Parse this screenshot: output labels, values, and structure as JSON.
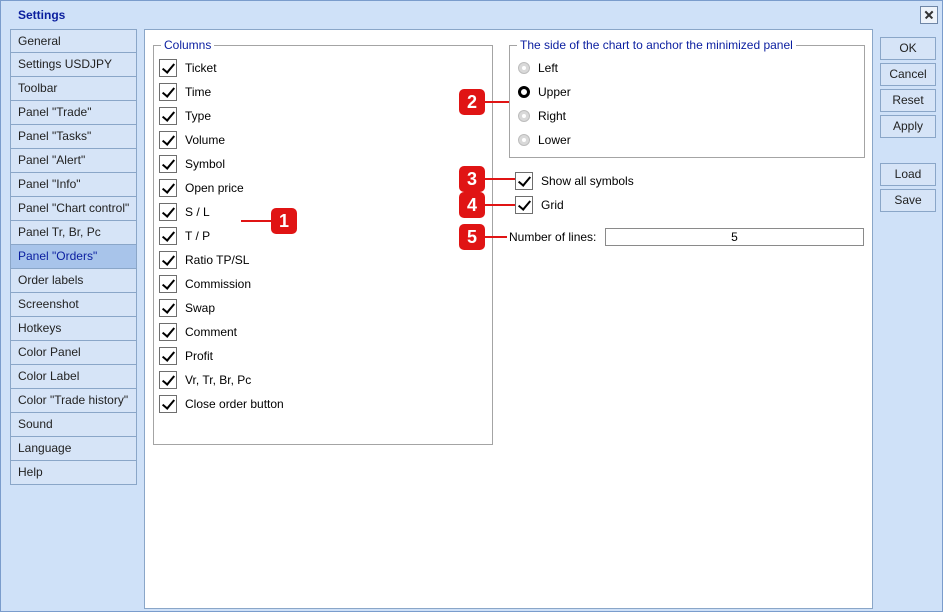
{
  "window": {
    "title": "Settings"
  },
  "sidebar": {
    "items": [
      {
        "label": "General"
      },
      {
        "label": "Settings USDJPY"
      },
      {
        "label": "Toolbar"
      },
      {
        "label": "Panel \"Trade\""
      },
      {
        "label": "Panel \"Tasks\""
      },
      {
        "label": "Panel \"Alert\""
      },
      {
        "label": "Panel \"Info\""
      },
      {
        "label": "Panel \"Chart control\""
      },
      {
        "label": "Panel Tr, Br, Pc"
      },
      {
        "label": "Panel \"Orders\"",
        "active": true
      },
      {
        "label": "Order labels"
      },
      {
        "label": "Screenshot"
      },
      {
        "label": "Hotkeys"
      },
      {
        "label": "Color Panel"
      },
      {
        "label": "Color Label"
      },
      {
        "label": "Color \"Trade history\""
      },
      {
        "label": "Sound"
      },
      {
        "label": "Language"
      },
      {
        "label": "Help"
      }
    ]
  },
  "columns": {
    "title": "Columns",
    "items": [
      {
        "label": "Ticket",
        "checked": true
      },
      {
        "label": "Time",
        "checked": true
      },
      {
        "label": "Type",
        "checked": true
      },
      {
        "label": "Volume",
        "checked": true
      },
      {
        "label": "Symbol",
        "checked": true
      },
      {
        "label": "Open price",
        "checked": true
      },
      {
        "label": "S / L",
        "checked": true
      },
      {
        "label": "T / P",
        "checked": true
      },
      {
        "label": "Ratio TP/SL",
        "checked": true
      },
      {
        "label": "Commission",
        "checked": true
      },
      {
        "label": "Swap",
        "checked": true
      },
      {
        "label": "Comment",
        "checked": true
      },
      {
        "label": "Profit",
        "checked": true
      },
      {
        "label": "Vr, Tr, Br, Pc",
        "checked": true
      },
      {
        "label": "Close order button",
        "checked": true
      }
    ]
  },
  "anchor": {
    "title": "The side of the chart to anchor the minimized panel",
    "options": [
      {
        "label": "Left",
        "selected": false
      },
      {
        "label": "Upper",
        "selected": true
      },
      {
        "label": "Right",
        "selected": false
      },
      {
        "label": "Lower",
        "selected": false
      }
    ]
  },
  "options": {
    "show_all_symbols": {
      "label": "Show all symbols",
      "checked": true
    },
    "grid": {
      "label": "Grid",
      "checked": true
    },
    "number_of_lines": {
      "label": "Number of lines:",
      "value": "5"
    }
  },
  "buttons": {
    "ok": "OK",
    "cancel": "Cancel",
    "reset": "Reset",
    "apply": "Apply",
    "load": "Load",
    "save": "Save"
  },
  "markers": [
    "1",
    "2",
    "3",
    "4",
    "5"
  ],
  "colors": {
    "accent": "#0a1ea0",
    "marker": "#e01414",
    "active_tab": "#a8c4ea"
  }
}
